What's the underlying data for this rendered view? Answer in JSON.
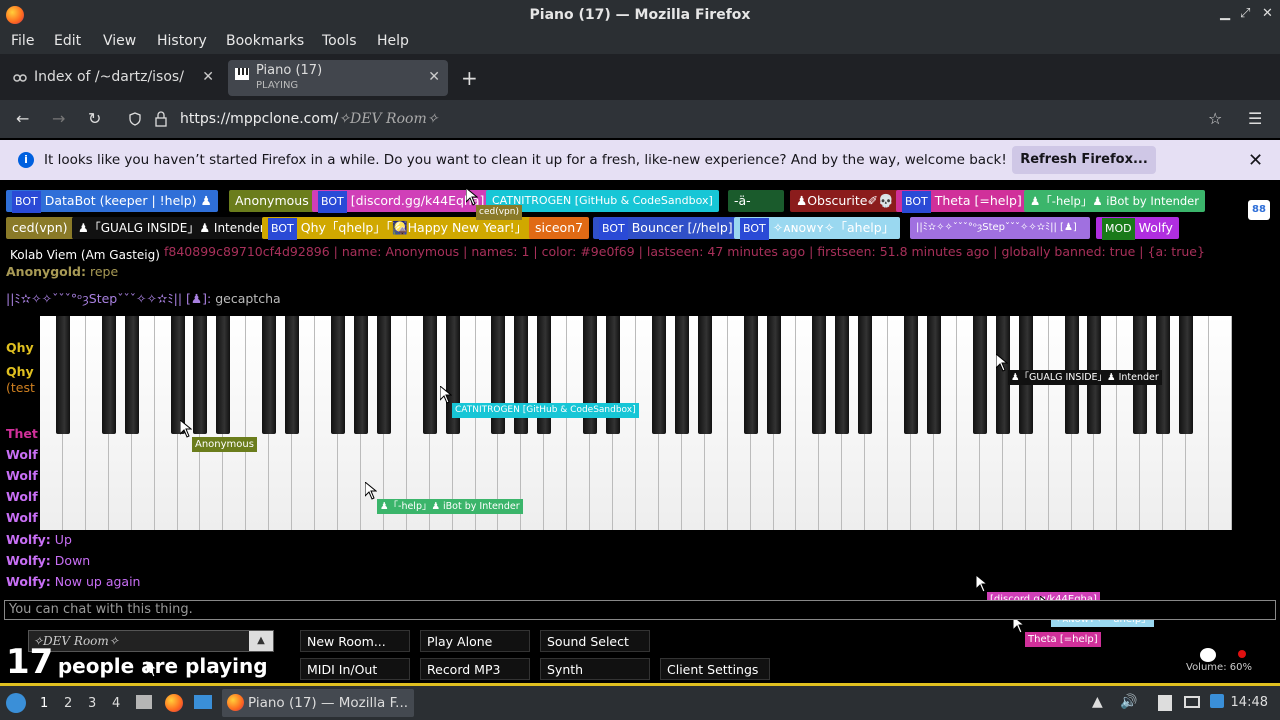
{
  "window": {
    "title": "Piano (17) — Mozilla Firefox"
  },
  "menu": [
    "File",
    "Edit",
    "View",
    "History",
    "Bookmarks",
    "Tools",
    "Help"
  ],
  "tabs": [
    {
      "label": "Index of /~dartz/isos/"
    },
    {
      "label": "Piano (17)",
      "sublabel": "PLAYING"
    }
  ],
  "address": {
    "host": "https://mppclone.com/",
    "path": "✧DEV Room✧"
  },
  "notification": {
    "text": "It looks like you haven’t started Firefox in a while. Do you want to clean it up for a fresh, like-new experience? And by the way, welcome back!",
    "button": "Refresh Firefox..."
  },
  "colors": {
    "bot_badge": "#2a4ad6",
    "mod_badge": "#1a7a1a",
    "chat_name": "#c86ff5",
    "notice_bg": "#e6e0f4"
  },
  "users": [
    {
      "bot": "BOT",
      "name": "DataBot (keeper | !help) ♟",
      "color": "#2f6fd8"
    },
    {
      "name": "Anonymous",
      "color": "#6b7d1c"
    },
    {
      "bot": "BOT",
      "name": "[discord.gg/k44Eqha]",
      "color": "#d03fb8"
    },
    {
      "name": "CATNITROGEN [GitHub & CodeSandbox]",
      "color": "#17c6d6"
    },
    {
      "name": "-ä-",
      "color": "#1a5b2c"
    },
    {
      "name": "♟Obscurite✐💀",
      "color": "#8b1c1c"
    },
    {
      "bot": "BOT",
      "name": "Theta [=help]",
      "color": "#d0309a"
    },
    {
      "name": "♟「-help」♟ iBot by Intender",
      "color": "#3bb56b"
    },
    {
      "name": "ced(vpn)",
      "color": "#8a7a28"
    },
    {
      "name": "♟「GUALG INSIDE」♟ Intender",
      "color": "#111111"
    },
    {
      "bot": "BOT",
      "name": "Qhy「qhelp」「🎑Happy New Year!」",
      "color": "#d0a800"
    },
    {
      "name": "siceon7",
      "color": "#e06a15"
    },
    {
      "bot": "BOT",
      "name": "Bouncer [//help]",
      "color": "#3050c8"
    },
    {
      "bot": "BOT",
      "name": "✧ᴀɴᴏᴡʏ✧「ahelp」",
      "color": "#9ad8f0"
    },
    {
      "name": "||ﾐ✫✧✧ˇˇˇ°ᵒȝStepˇˇˇ✧✧✫ﾐ|| [♟]",
      "color": "#a070e0"
    },
    {
      "bot": "MOD",
      "name": "Wolfy",
      "color": "#b02ee0"
    },
    {
      "name": "Kolab Viem (Am Gasteig)",
      "color": "#000000"
    }
  ],
  "chat": {
    "info_line": "f840899c89710cf4d92896 | name: Anonymous | names: 1 | color: #9e0f69 | lastseen: 47 minutes ago | firstseen: 51.8 minutes ago | globally banned: true | {a: true}",
    "messages": [
      {
        "name": "Anonygold:",
        "text": "repe"
      },
      {
        "name": "||ﾐ✫✧✧ˇˇˇ°ᵒȝStepˇˇˇ✧✧✫ﾐ|| [♟]:",
        "text": "gecaptcha"
      },
      {
        "name": "Wolfy:",
        "text": "Up"
      },
      {
        "name": "Wolfy:",
        "text": "Down"
      },
      {
        "name": "Wolfy:",
        "text": "Now up again"
      }
    ],
    "side_names": [
      "Qhy",
      "Qhy",
      "(test",
      "Thet",
      "Wolf",
      "Wolf",
      "Wolf",
      "Wolf"
    ],
    "placeholder": "You can chat with this thing."
  },
  "cursors": [
    {
      "label": "CATNITROGEN [GitHub & CodeSandbox]",
      "color": "#17c6d6"
    },
    {
      "label": "Anonymous",
      "color": "#6b7d1c"
    },
    {
      "label": "♟「-help」♟ iBot by Intender",
      "color": "#3bb56b"
    },
    {
      "label": "♟「GUALG INSIDE」♟ Intender",
      "color": "#111111"
    },
    {
      "label": "[discord.gg/k44Eqha]",
      "color": "#d03fb8"
    },
    {
      "label": "✧ᴀɴᴏᴡʏ✧「ahelp」",
      "color": "#9ad8f0"
    },
    {
      "label": "Theta [=help]",
      "color": "#d0309a"
    },
    {
      "label": "ced(vpn)",
      "color": "#8a7a28"
    }
  ],
  "controls": {
    "room_select": "✧DEV Room✧",
    "player_count": "17",
    "player_text": "people are playing",
    "buttons": [
      "New Room...",
      "Play Alone",
      "Sound Select",
      "MIDI In/Out",
      "Record MP3",
      "Synth",
      "Client Settings"
    ],
    "volume": "Volume: 60%"
  },
  "taskbar": {
    "workspaces": [
      "1",
      "2",
      "3",
      "4"
    ],
    "task_label": "Piano (17) — Mozilla F...",
    "clock": "14:48"
  }
}
